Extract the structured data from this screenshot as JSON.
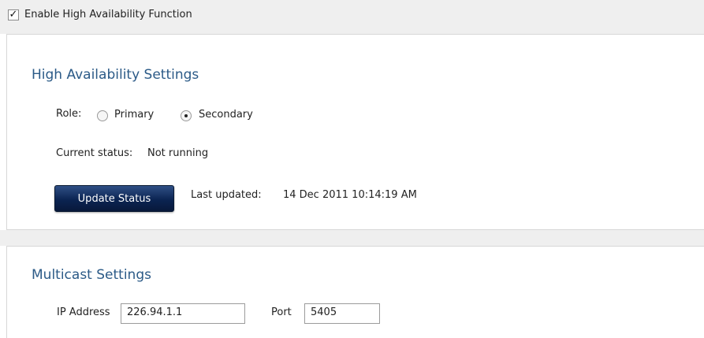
{
  "top": {
    "checkbox_checked": true,
    "checkbox_label": "Enable High Availability Function"
  },
  "ha_settings": {
    "title": "High Availability Settings",
    "role_label": "Role:",
    "role_options": [
      "Primary",
      "Secondary"
    ],
    "role_selected": "Secondary",
    "current_status_label": "Current status:",
    "current_status_value": "Not running",
    "update_button_label": "Update Status",
    "last_updated_label": "Last updated:",
    "last_updated_value": "14 Dec 2011 10:14:19 AM"
  },
  "multicast_settings": {
    "title": "Multicast Settings",
    "ip_label": "IP Address",
    "ip_value": "226.94.1.1",
    "port_label": "Port",
    "port_value": "5405"
  }
}
